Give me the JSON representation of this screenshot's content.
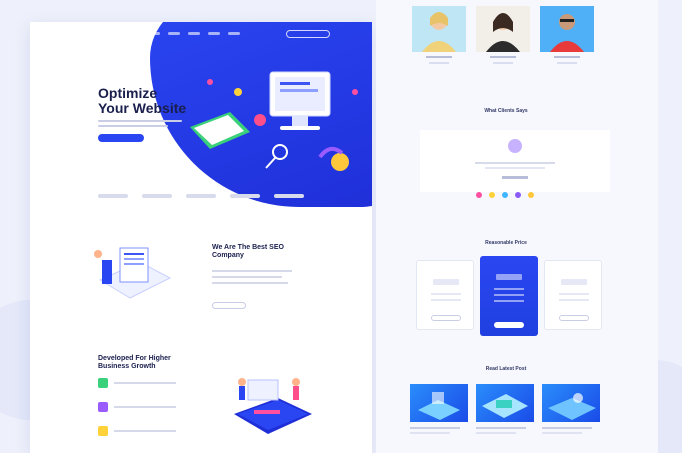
{
  "hero": {
    "title_line1": "Optimize",
    "title_line2": "Your Website"
  },
  "section1": {
    "title": "We Are The Best SEO Company"
  },
  "section2": {
    "title": "Developed For Higher Business Growth"
  },
  "right": {
    "testimonials_title": "What Clients Says",
    "pricing_title": "Reasonable Price",
    "blog_title": "Read Latest Post"
  },
  "colors": {
    "primary_blue": "#2a46f2",
    "dot_colors": [
      "#ff4fa0",
      "#ffd23a",
      "#3fb6ff",
      "#8b5cf6",
      "#ffc83a"
    ]
  },
  "icons": [
    "monitor-illustration",
    "server-illustration",
    "card-illustration"
  ]
}
